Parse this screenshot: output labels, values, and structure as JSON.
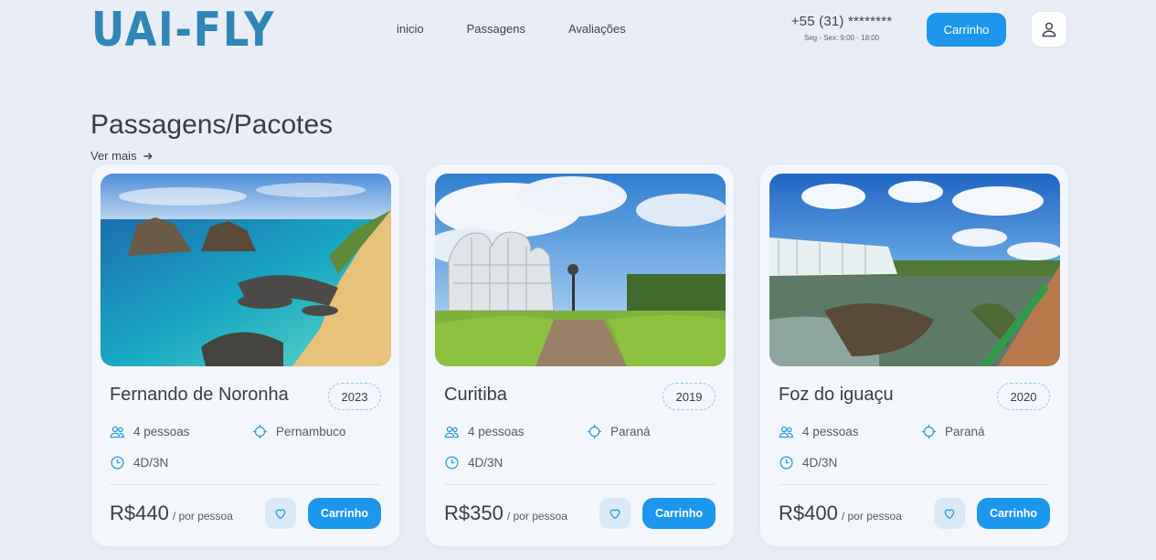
{
  "header": {
    "logo": "UAI-FLY",
    "nav": [
      "inicio",
      "Passagens",
      "Avaliações"
    ],
    "phone": "+55 (31) ********",
    "hours": "Seg - Sex: 9:00 - 18:00",
    "cart_label": "Carrinho"
  },
  "section": {
    "title": "Passagens/Pacotes",
    "more_label": "Ver mais"
  },
  "cards": [
    {
      "name": "Fernando de Noronha",
      "year": "2023",
      "people": "4 pessoas",
      "state": "Pernambuco",
      "duration": "4D/3N",
      "price": "R$440",
      "per": "/ por pessoa",
      "cart_label": "Carrinho"
    },
    {
      "name": "Curitiba",
      "year": "2019",
      "people": "4 pessoas",
      "state": "Paraná",
      "duration": "4D/3N",
      "price": "R$350",
      "per": "/ por pessoa",
      "cart_label": "Carrinho"
    },
    {
      "name": "Foz do iguaçu",
      "year": "2020",
      "people": "4 pessoas",
      "state": "Paraná",
      "duration": "4D/3N",
      "price": "R$400",
      "per": "/ por pessoa",
      "cart_label": "Carrinho"
    }
  ],
  "colors": {
    "accent": "#1c97ec",
    "logo": "#2f86b8",
    "background": "#e9eef6"
  }
}
